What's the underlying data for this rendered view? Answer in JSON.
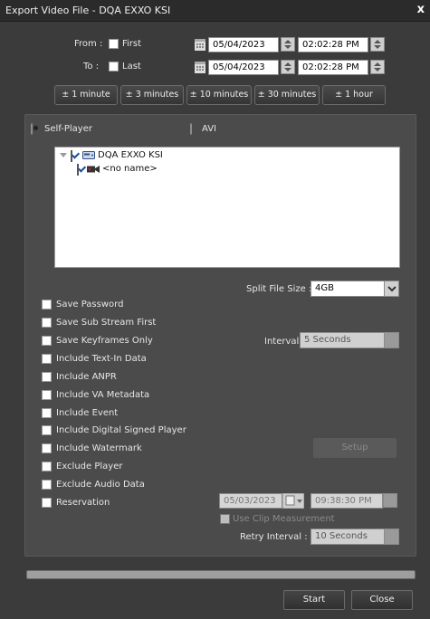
{
  "window": {
    "title": "Export Video File - DQA EXXO KSI",
    "close_glyph": "x"
  },
  "range": {
    "from_label": "From :",
    "from_check_label": "First",
    "from_date": "05/04/2023",
    "from_time": "02:02:28 PM",
    "to_label": "To :",
    "to_check_label": "Last",
    "to_date": "05/04/2023",
    "to_time": "02:02:28 PM"
  },
  "time_buttons": [
    "± 1 minute",
    "± 3 minutes",
    "± 10 minutes",
    "± 30 minutes",
    "± 1 hour"
  ],
  "format": {
    "self_player": "Self-Player",
    "avi": "AVI",
    "selected": "Self-Player"
  },
  "tree": {
    "root": "DQA EXXO KSI",
    "child": "<no name>"
  },
  "split": {
    "label": "Split File Size :",
    "value": "4GB"
  },
  "options": [
    "Save Password",
    "Save Sub Stream First",
    "Save Keyframes Only",
    "Include Text-In Data",
    "Include ANPR",
    "Include VA Metadata",
    "Include Event",
    "Include Digital Signed Player",
    "Include Watermark",
    "Exclude Player",
    "Exclude Audio Data",
    "Reservation"
  ],
  "interval": {
    "label": "Interval :",
    "value": "5 Seconds"
  },
  "setup_label": "Setup",
  "reservation": {
    "date": "05/03/2023",
    "time": "09:38:30 PM"
  },
  "clip_measurement_label": "Use Clip Measurement",
  "retry": {
    "label": "Retry Interval :",
    "value": "10 Seconds"
  },
  "actions": {
    "start": "Start",
    "close": "Close"
  },
  "colors": {
    "background": "#3b3b3b",
    "panel": "#4b4b4b",
    "titlebar": "#2b2b2b"
  }
}
